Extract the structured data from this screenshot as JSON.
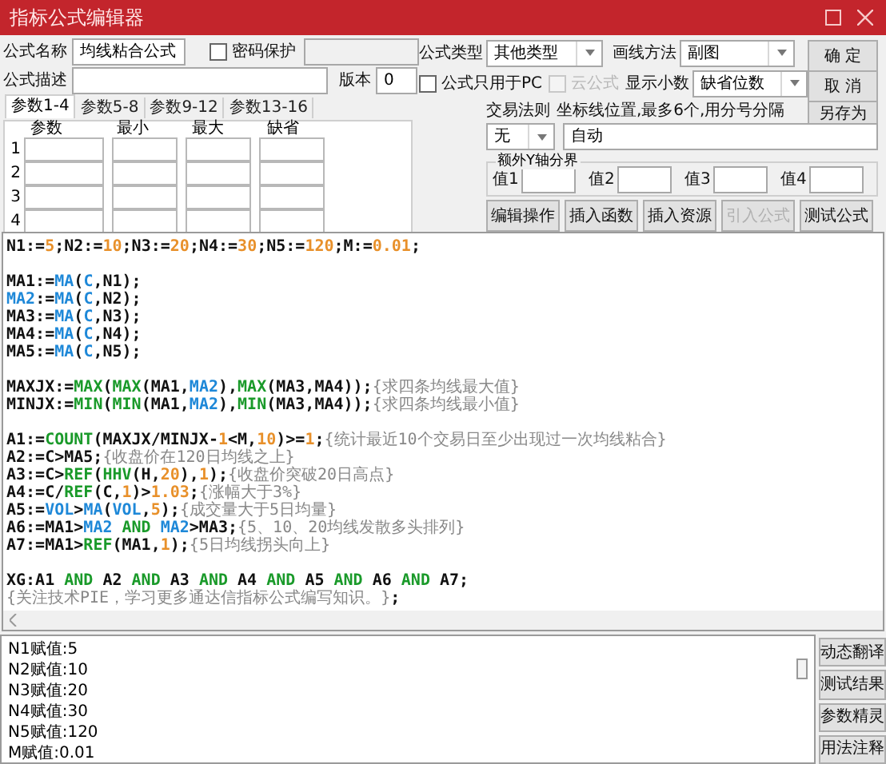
{
  "window": {
    "title": "指标公式编辑器"
  },
  "form": {
    "name_label": "公式名称",
    "name": "均线粘合公式",
    "password": {
      "label": "密码保护",
      "checked": false
    },
    "description_label": "公式描述",
    "version_label": "版本",
    "version": "0",
    "type_label": "公式类型",
    "type": "其他类型",
    "draw_label": "画线方法",
    "draw": "副图",
    "pc_only": {
      "label": "公式只用于PC",
      "checked": false
    },
    "cloud": {
      "label": "云公式",
      "checked": false,
      "disabled": true
    },
    "decimals_label": "显示小数",
    "decimals": "缺省位数",
    "trade_rule_label": "交易法则",
    "trade_rule": "无",
    "axis_label": "坐标线位置,最多6个,用分号分隔",
    "axis": "自动",
    "extra_y": {
      "title": "额外Y轴分界",
      "values": [
        {
          "label": "值1"
        },
        {
          "label": "值2"
        },
        {
          "label": "值3"
        },
        {
          "label": "值4"
        }
      ]
    }
  },
  "side_buttons": [
    {
      "label": "确 定"
    },
    {
      "label": "取 消"
    },
    {
      "label": "另存为"
    }
  ],
  "param_tabs": [
    {
      "label": "参数1-4",
      "selected": true
    },
    {
      "label": "参数5-8",
      "selected": false
    },
    {
      "label": "参数9-12",
      "selected": false
    },
    {
      "label": "参数13-16",
      "selected": false
    }
  ],
  "param_table": {
    "columns": [
      "参数",
      "最小",
      "最大",
      "缺省"
    ],
    "rows": [
      "1",
      "2",
      "3",
      "4"
    ]
  },
  "tool_buttons": [
    {
      "label": "编辑操作",
      "disabled": false
    },
    {
      "label": "插入函数",
      "disabled": false
    },
    {
      "label": "插入资源",
      "disabled": false
    },
    {
      "label": "引入公式",
      "disabled": true
    },
    {
      "label": "测试公式",
      "disabled": false
    }
  ],
  "code": [
    {
      "kind": "code",
      "segments": [
        {
          "t": "N1:=",
          "kind": "plain"
        },
        {
          "t": "5",
          "kind": "number"
        },
        {
          "t": ";N2:=",
          "kind": "plain"
        },
        {
          "t": "10",
          "kind": "number"
        },
        {
          "t": ";N3:=",
          "kind": "plain"
        },
        {
          "t": "20",
          "kind": "number"
        },
        {
          "t": ";N4:=",
          "kind": "plain"
        },
        {
          "t": "30",
          "kind": "number"
        },
        {
          "t": ";N5:=",
          "kind": "plain"
        },
        {
          "t": "120",
          "kind": "number"
        },
        {
          "t": ";M:=",
          "kind": "plain"
        },
        {
          "t": "0.01",
          "kind": "number"
        },
        {
          "t": ";",
          "kind": "plain"
        }
      ]
    },
    {
      "kind": "blank"
    },
    {
      "kind": "code",
      "segments": [
        {
          "t": "MA1:=",
          "kind": "plain"
        },
        {
          "t": "MA",
          "kind": "variable"
        },
        {
          "t": "(",
          "kind": "plain"
        },
        {
          "t": "C",
          "kind": "variable"
        },
        {
          "t": ",N1);",
          "kind": "plain"
        }
      ]
    },
    {
      "kind": "code",
      "segments": [
        {
          "t": "MA2",
          "kind": "variable"
        },
        {
          "t": ":=",
          "kind": "plain"
        },
        {
          "t": "MA",
          "kind": "variable"
        },
        {
          "t": "(",
          "kind": "plain"
        },
        {
          "t": "C",
          "kind": "variable"
        },
        {
          "t": ",N2);",
          "kind": "plain"
        }
      ]
    },
    {
      "kind": "code",
      "segments": [
        {
          "t": "MA3:=",
          "kind": "plain"
        },
        {
          "t": "MA",
          "kind": "variable"
        },
        {
          "t": "(",
          "kind": "plain"
        },
        {
          "t": "C",
          "kind": "variable"
        },
        {
          "t": ",N3);",
          "kind": "plain"
        }
      ]
    },
    {
      "kind": "code",
      "segments": [
        {
          "t": "MA4:=",
          "kind": "plain"
        },
        {
          "t": "MA",
          "kind": "variable"
        },
        {
          "t": "(",
          "kind": "plain"
        },
        {
          "t": "C",
          "kind": "variable"
        },
        {
          "t": ",N4);",
          "kind": "plain"
        }
      ]
    },
    {
      "kind": "code",
      "segments": [
        {
          "t": "MA5:=",
          "kind": "plain"
        },
        {
          "t": "MA",
          "kind": "variable"
        },
        {
          "t": "(",
          "kind": "plain"
        },
        {
          "t": "C",
          "kind": "variable"
        },
        {
          "t": ",N5);",
          "kind": "plain"
        }
      ]
    },
    {
      "kind": "blank"
    },
    {
      "kind": "code",
      "segments": [
        {
          "t": "MAXJX:=",
          "kind": "plain"
        },
        {
          "t": "MAX",
          "kind": "function"
        },
        {
          "t": "(",
          "kind": "plain"
        },
        {
          "t": "MAX",
          "kind": "function"
        },
        {
          "t": "(MA1,",
          "kind": "plain"
        },
        {
          "t": "MA2",
          "kind": "variable"
        },
        {
          "t": "),",
          "kind": "plain"
        },
        {
          "t": "MAX",
          "kind": "function"
        },
        {
          "t": "(MA3,MA4));",
          "kind": "plain"
        },
        {
          "t": "{求四条均线最大值}",
          "kind": "comment"
        }
      ]
    },
    {
      "kind": "code",
      "segments": [
        {
          "t": "MINJX:=",
          "kind": "plain"
        },
        {
          "t": "MIN",
          "kind": "function"
        },
        {
          "t": "(",
          "kind": "plain"
        },
        {
          "t": "MIN",
          "kind": "function"
        },
        {
          "t": "(MA1,",
          "kind": "plain"
        },
        {
          "t": "MA2",
          "kind": "variable"
        },
        {
          "t": "),",
          "kind": "plain"
        },
        {
          "t": "MIN",
          "kind": "function"
        },
        {
          "t": "(MA3,MA4));",
          "kind": "plain"
        },
        {
          "t": "{求四条均线最小值}",
          "kind": "comment"
        }
      ]
    },
    {
      "kind": "blank"
    },
    {
      "kind": "code",
      "segments": [
        {
          "t": "A1:=",
          "kind": "plain"
        },
        {
          "t": "COUNT",
          "kind": "function"
        },
        {
          "t": "(MAXJX/MINJX-",
          "kind": "plain"
        },
        {
          "t": "1",
          "kind": "number"
        },
        {
          "t": "<M,",
          "kind": "plain"
        },
        {
          "t": "10",
          "kind": "number"
        },
        {
          "t": ")>=",
          "kind": "plain"
        },
        {
          "t": "1",
          "kind": "number"
        },
        {
          "t": ";",
          "kind": "plain"
        },
        {
          "t": "{统计最近10个交易日至少出现过一次均线粘合}",
          "kind": "comment"
        }
      ]
    },
    {
      "kind": "code",
      "segments": [
        {
          "t": "A2:=C>MA5;",
          "kind": "plain"
        },
        {
          "t": "{收盘价在120日均线之上}",
          "kind": "comment"
        }
      ]
    },
    {
      "kind": "code",
      "segments": [
        {
          "t": "A3:=C>",
          "kind": "plain"
        },
        {
          "t": "REF",
          "kind": "function"
        },
        {
          "t": "(",
          "kind": "plain"
        },
        {
          "t": "HHV",
          "kind": "function"
        },
        {
          "t": "(H,",
          "kind": "plain"
        },
        {
          "t": "20",
          "kind": "number"
        },
        {
          "t": "),",
          "kind": "plain"
        },
        {
          "t": "1",
          "kind": "number"
        },
        {
          "t": ");",
          "kind": "plain"
        },
        {
          "t": "{收盘价突破20日高点}",
          "kind": "comment"
        }
      ]
    },
    {
      "kind": "code",
      "segments": [
        {
          "t": "A4:=C/",
          "kind": "plain"
        },
        {
          "t": "REF",
          "kind": "function"
        },
        {
          "t": "(C,",
          "kind": "plain"
        },
        {
          "t": "1",
          "kind": "number"
        },
        {
          "t": ")>",
          "kind": "plain"
        },
        {
          "t": "1.03",
          "kind": "number"
        },
        {
          "t": ";",
          "kind": "plain"
        },
        {
          "t": "{涨幅大于3%}",
          "kind": "comment"
        }
      ]
    },
    {
      "kind": "code",
      "segments": [
        {
          "t": "A5:=",
          "kind": "plain"
        },
        {
          "t": "VOL",
          "kind": "variable"
        },
        {
          "t": ">",
          "kind": "plain"
        },
        {
          "t": "MA",
          "kind": "variable"
        },
        {
          "t": "(",
          "kind": "plain"
        },
        {
          "t": "VOL",
          "kind": "variable"
        },
        {
          "t": ",",
          "kind": "plain"
        },
        {
          "t": "5",
          "kind": "number"
        },
        {
          "t": ");",
          "kind": "plain"
        },
        {
          "t": "{成交量大于5日均量}",
          "kind": "comment"
        }
      ]
    },
    {
      "kind": "code",
      "segments": [
        {
          "t": "A6:=MA1>",
          "kind": "plain"
        },
        {
          "t": "MA2",
          "kind": "variable"
        },
        {
          "t": " AND ",
          "kind": "function"
        },
        {
          "t": "MA2",
          "kind": "variable"
        },
        {
          "t": ">MA3;",
          "kind": "plain"
        },
        {
          "t": "{5、10、20均线发散多头排列}",
          "kind": "comment"
        }
      ]
    },
    {
      "kind": "code",
      "segments": [
        {
          "t": "A7:=MA1>",
          "kind": "plain"
        },
        {
          "t": "REF",
          "kind": "function"
        },
        {
          "t": "(MA1,",
          "kind": "plain"
        },
        {
          "t": "1",
          "kind": "number"
        },
        {
          "t": ");",
          "kind": "plain"
        },
        {
          "t": "{5日均线拐头向上}",
          "kind": "comment"
        }
      ]
    },
    {
      "kind": "blank"
    },
    {
      "kind": "code",
      "segments": [
        {
          "t": "XG:A1",
          "kind": "plain"
        },
        {
          "t": " AND ",
          "kind": "function"
        },
        {
          "t": "A2",
          "kind": "plain"
        },
        {
          "t": " AND ",
          "kind": "function"
        },
        {
          "t": "A3",
          "kind": "plain"
        },
        {
          "t": " AND ",
          "kind": "function"
        },
        {
          "t": "A4",
          "kind": "plain"
        },
        {
          "t": " AND ",
          "kind": "function"
        },
        {
          "t": "A5",
          "kind": "plain"
        },
        {
          "t": " AND ",
          "kind": "function"
        },
        {
          "t": "A6",
          "kind": "plain"
        },
        {
          "t": " AND ",
          "kind": "function"
        },
        {
          "t": "A7;",
          "kind": "plain"
        }
      ]
    },
    {
      "kind": "code",
      "segments": [
        {
          "t": "{关注技术PIE，学习更多通达信指标公式编写知识。}",
          "kind": "comment"
        },
        {
          "t": ";",
          "kind": "plain"
        }
      ]
    }
  ],
  "output": [
    "N1赋值:5",
    "N2赋值:10",
    "N3赋值:20",
    "N4赋值:30",
    "N5赋值:120",
    "M赋值:0.01"
  ],
  "output_buttons": [
    {
      "label": "动态翻译"
    },
    {
      "label": "测试结果"
    },
    {
      "label": "参数精灵"
    },
    {
      "label": "用法注释"
    }
  ]
}
